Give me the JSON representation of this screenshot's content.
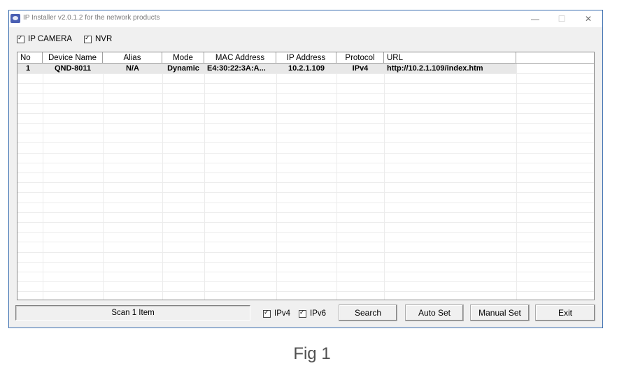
{
  "window": {
    "title": "IP Installer v2.0.1.2 for the network products",
    "minimize_label": "—",
    "maximize_label": "☐",
    "close_label": "✕"
  },
  "filters": {
    "ip_camera": {
      "label": "IP CAMERA",
      "checked": true
    },
    "nvr": {
      "label": "NVR",
      "checked": true
    }
  },
  "table": {
    "columns": [
      "No",
      "Device Name",
      "Alias",
      "Mode",
      "MAC Address",
      "IP Address",
      "Protocol",
      "URL"
    ],
    "rows": [
      [
        "1",
        "QND-8011",
        "N/A",
        "Dynamic",
        "E4:30:22:3A:A...",
        "10.2.1.109",
        "IPv4",
        "http://10.2.1.109/index.htm"
      ]
    ]
  },
  "footer": {
    "status_text": "Scan 1 Item",
    "ipv4": {
      "label": "IPv4",
      "checked": true
    },
    "ipv6": {
      "label": "IPv6",
      "checked": true
    },
    "buttons": {
      "search": "Search",
      "auto_set": "Auto Set",
      "manual_set": "Manual Set",
      "exit": "Exit"
    }
  },
  "caption": "Fig 1"
}
